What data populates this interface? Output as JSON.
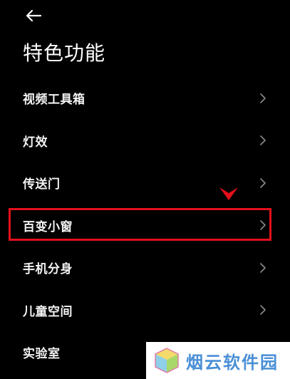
{
  "header": {
    "back_icon": "arrow-left-icon",
    "title": "特色功能"
  },
  "menu": {
    "items": [
      {
        "label": "视频工具箱",
        "icon": "chevron-right-icon"
      },
      {
        "label": "灯效",
        "icon": "chevron-right-icon"
      },
      {
        "label": "传送门",
        "icon": "chevron-right-icon"
      },
      {
        "label": "百变小窗",
        "icon": "chevron-right-icon",
        "highlighted": true
      },
      {
        "label": "手机分身",
        "icon": "chevron-right-icon"
      },
      {
        "label": "儿童空间",
        "icon": "chevron-right-icon"
      },
      {
        "label": "实验室",
        "icon": "chevron-right-icon"
      }
    ]
  },
  "annotation": {
    "highlight_color": "#e3101b",
    "pointer_icon": "down-arrow-marker-icon"
  },
  "watermark": {
    "text": "烟云软件园",
    "text_color": "#4a8fd6",
    "logo_icon": "cube-logo-icon"
  },
  "colors": {
    "background": "#000000",
    "text": "#ffffff",
    "chevron": "#8a8a8a"
  }
}
